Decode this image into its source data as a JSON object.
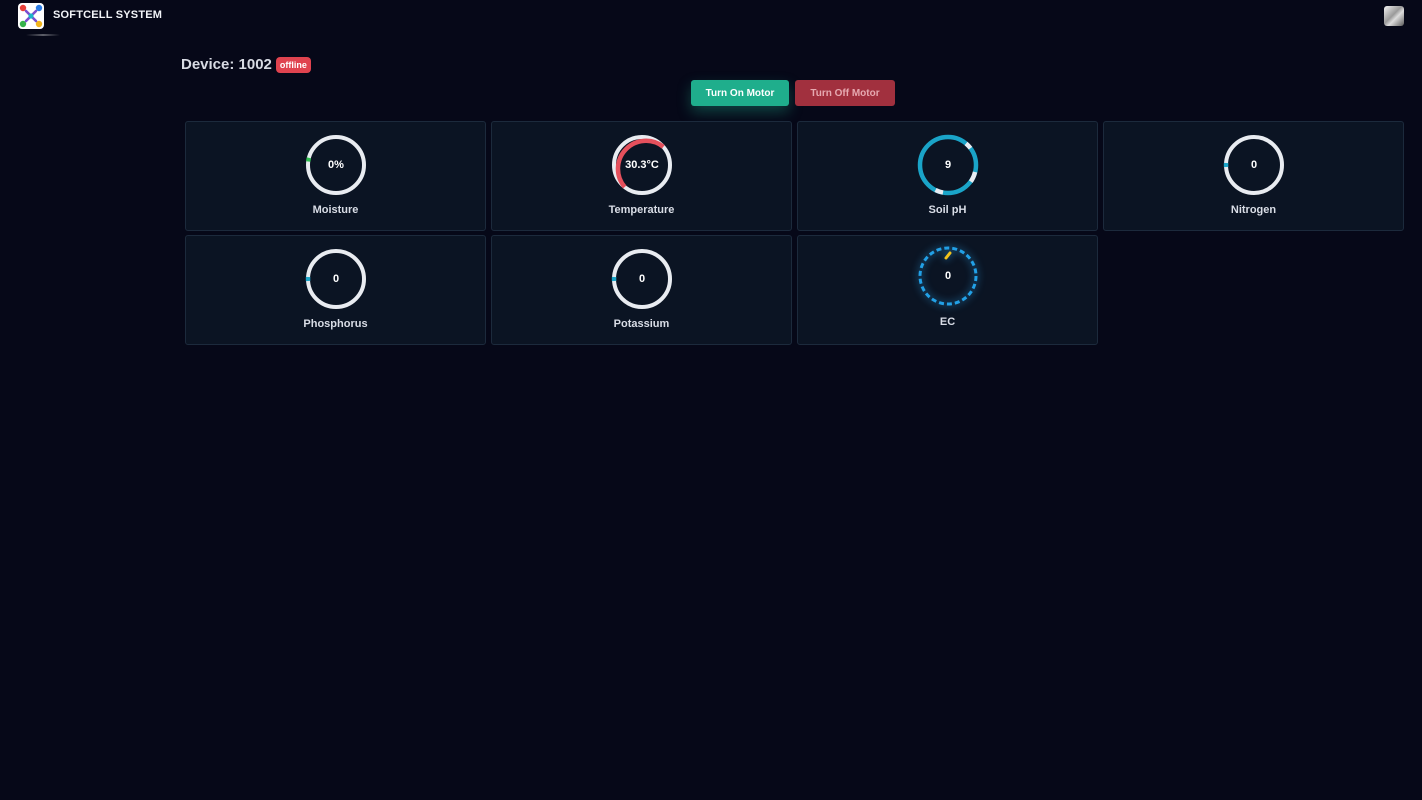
{
  "header": {
    "brand": "SOFTCELL SYSTEM",
    "logo_icon": "softcell-logo-icon",
    "avatar_icon": "user-avatar-icon"
  },
  "device": {
    "label": "Device: 1002",
    "status": "offline"
  },
  "motor": {
    "on_label": "Turn On Motor",
    "off_label": "Turn Off Motor"
  },
  "colors": {
    "background": "#060818",
    "card": "#0b1423",
    "motor_on": "#1fae8c",
    "motor_off": "#a1303e",
    "status_offline": "#e0434f",
    "gauge_track": "#e9ecf1",
    "temperature": "#e5505c",
    "soil_ph": "#1aa4c8",
    "moisture": "#2fbf4f",
    "ec": "#22a0e6",
    "ec_marker": "#f2c21a"
  },
  "sensors": [
    {
      "label": "Moisture",
      "value": "0%"
    },
    {
      "label": "Temperature",
      "value": "30.3°C"
    },
    {
      "label": "Soil pH",
      "value": "9"
    },
    {
      "label": "Nitrogen",
      "value": "0"
    },
    {
      "label": "Phosphorus",
      "value": "0"
    },
    {
      "label": "Potassium",
      "value": "0"
    },
    {
      "label": "EC",
      "value": "0"
    }
  ]
}
